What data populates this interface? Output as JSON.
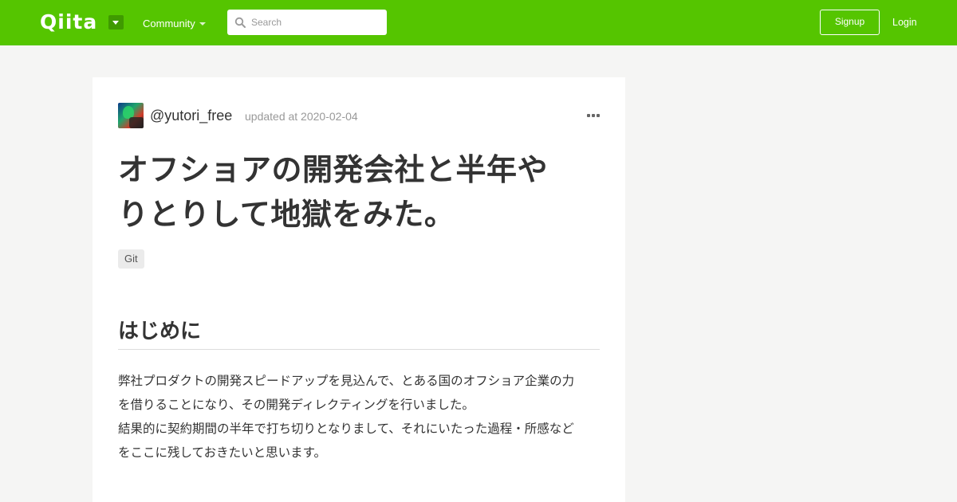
{
  "header": {
    "logo": "Qiita",
    "community_label": "Community",
    "search_placeholder": "Search",
    "signup_label": "Signup",
    "login_label": "Login",
    "brand_color": "#55c500"
  },
  "article": {
    "username": "@yutori_free",
    "updated": "updated at 2020-02-04",
    "title_lines": [
      "オフショアの開発会社と半年や",
      "りとりして地獄をみた。"
    ],
    "tags": [
      "Git"
    ],
    "section_heading": "はじめに",
    "paragraph_lines": [
      "弊社プロダクトの開発スピードアップを見込んで、とある国のオフショア企業の力",
      "を借りることになり、その開発ディレクティングを行いました。",
      "結果的に契約期間の半年で打ち切りとなりまして、それにいたった過程・所感など",
      "をここに残しておきたいと思います。"
    ]
  }
}
